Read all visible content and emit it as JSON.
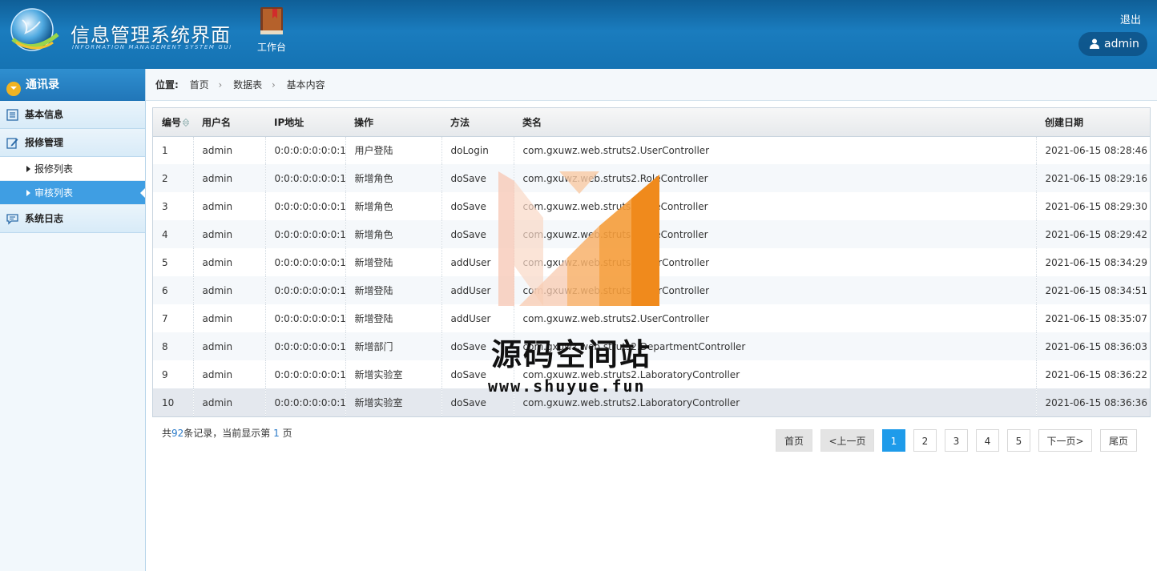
{
  "header": {
    "title": "信息管理系统界面",
    "subtitle": "INFORMATION MANAGEMENT SYSTEM GUI",
    "workbench_label": "工作台",
    "logout_label": "退出",
    "username": "admin"
  },
  "sidebar": {
    "section_title": "通讯录",
    "items": [
      {
        "label": "基本信息",
        "icon": "list-icon"
      },
      {
        "label": "报修管理",
        "icon": "edit-icon"
      },
      {
        "label": "系统日志",
        "icon": "message-icon"
      }
    ],
    "subitems": [
      {
        "label": "报修列表",
        "active": false
      },
      {
        "label": "审核列表",
        "active": true
      }
    ]
  },
  "breadcrumb": {
    "label": "位置:",
    "items": [
      "首页",
      "数据表",
      "基本内容"
    ],
    "separator": "›"
  },
  "table": {
    "columns": [
      "编号",
      "用户名",
      "IP地址",
      "操作",
      "方法",
      "类名",
      "创建日期"
    ],
    "sort_icon": "sort-icon",
    "rows": [
      [
        "1",
        "admin",
        "0:0:0:0:0:0:0:1",
        "用户登陆",
        "doLogin",
        "com.gxuwz.web.struts2.UserController",
        "2021-06-15 08:28:46"
      ],
      [
        "2",
        "admin",
        "0:0:0:0:0:0:0:1",
        "新增角色",
        "doSave",
        "com.gxuwz.web.struts2.RoleController",
        "2021-06-15 08:29:16"
      ],
      [
        "3",
        "admin",
        "0:0:0:0:0:0:0:1",
        "新增角色",
        "doSave",
        "com.gxuwz.web.struts2.RoleController",
        "2021-06-15 08:29:30"
      ],
      [
        "4",
        "admin",
        "0:0:0:0:0:0:0:1",
        "新增角色",
        "doSave",
        "com.gxuwz.web.struts2.RoleController",
        "2021-06-15 08:29:42"
      ],
      [
        "5",
        "admin",
        "0:0:0:0:0:0:0:1",
        "新增登陆",
        "addUser",
        "com.gxuwz.web.struts2.UserController",
        "2021-06-15 08:34:29"
      ],
      [
        "6",
        "admin",
        "0:0:0:0:0:0:0:1",
        "新增登陆",
        "addUser",
        "com.gxuwz.web.struts2.UserController",
        "2021-06-15 08:34:51"
      ],
      [
        "7",
        "admin",
        "0:0:0:0:0:0:0:1",
        "新增登陆",
        "addUser",
        "com.gxuwz.web.struts2.UserController",
        "2021-06-15 08:35:07"
      ],
      [
        "8",
        "admin",
        "0:0:0:0:0:0:0:1",
        "新增部门",
        "doSave",
        "com.gxuwz.web.struts2.DepartmentController",
        "2021-06-15 08:36:03"
      ],
      [
        "9",
        "admin",
        "0:0:0:0:0:0:0:1",
        "新增实验室",
        "doSave",
        "com.gxuwz.web.struts2.LaboratoryController",
        "2021-06-15 08:36:22"
      ],
      [
        "10",
        "admin",
        "0:0:0:0:0:0:0:1",
        "新增实验室",
        "doSave",
        "com.gxuwz.web.struts2.LaboratoryController",
        "2021-06-15 08:36:36"
      ]
    ]
  },
  "footer": {
    "records_prefix": "共",
    "records_total": "92",
    "records_mid": "条记录，当前显示第",
    "records_page": "1",
    "records_suffix": "页"
  },
  "pagination": {
    "first": "首页",
    "prev": "<上一页",
    "pages": [
      "1",
      "2",
      "3",
      "4",
      "5"
    ],
    "current": "1",
    "next": "下一页>",
    "last": "尾页"
  },
  "watermark": {
    "text": "源码空间站",
    "url": "www.shuyue.fun"
  },
  "colors": {
    "header_blue": "#1573b3",
    "active_blue": "#3f9ee3",
    "page_current": "#1e9bea",
    "watermark_orange": "#f08a1c"
  }
}
